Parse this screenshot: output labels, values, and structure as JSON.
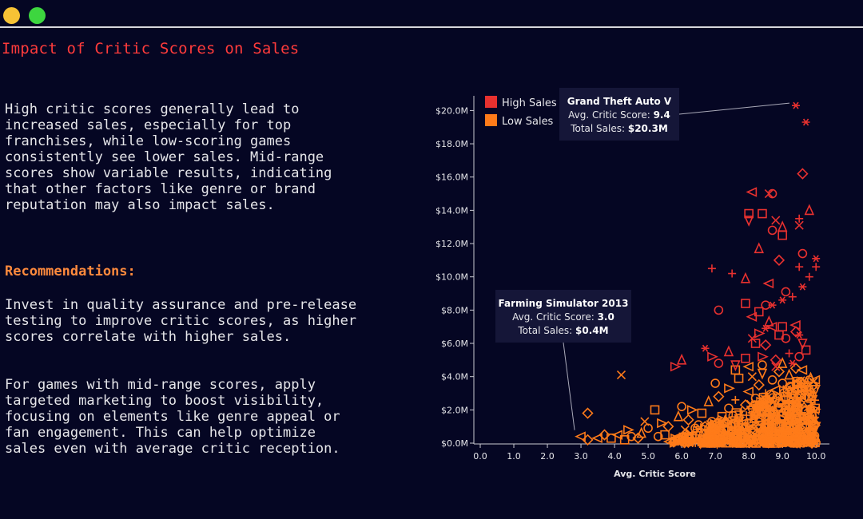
{
  "window": {
    "dots": [
      {
        "icon": "minimize-dot-icon",
        "color": "#f7c235"
      },
      {
        "icon": "maximize-dot-icon",
        "color": "#3dd63f"
      }
    ],
    "divider_color": "#d7d7dc"
  },
  "title": "Impact of Critic Scores on Sales",
  "colors": {
    "title": "#ff3b3b",
    "heading": "#ff8a3d",
    "text": "#e6e6ea",
    "background": "#050623",
    "high_sales": "#e8312f",
    "low_sales": "#ff7b19",
    "tooltip_bg": "#151638"
  },
  "insight": "High critic scores generally lead to increased sales, especially for top franchises, while low-scoring games consistently see lower sales. Mid-range scores show variable results, indicating that other factors like genre or brand reputation may also impact sales.",
  "recommendations": {
    "heading": "Recommendations:",
    "items": [
      "Invest in quality assurance and pre-release testing to improve critic scores, as higher scores correlate with higher sales.",
      "For games with mid-range scores, apply targeted marketing to boost visibility, focusing on elements like genre appeal or fan engagement. This can help optimize sales even with average critic reception."
    ]
  },
  "chart_data": {
    "type": "scatter",
    "xlabel": "Avg. Critic Score",
    "ylabel": "",
    "xlim": [
      0,
      10.4
    ],
    "ylim": [
      0,
      20.5
    ],
    "x_ticks": [
      0,
      1,
      2,
      3,
      4,
      5,
      6,
      7,
      8,
      9,
      10
    ],
    "x_tick_labels": [
      "0.0",
      "1.0",
      "2.0",
      "3.0",
      "4.0",
      "5.0",
      "6.0",
      "7.0",
      "8.0",
      "9.0",
      "10.0"
    ],
    "y_ticks": [
      0,
      2,
      4,
      6,
      8,
      10,
      12,
      14,
      16,
      18,
      20
    ],
    "y_tick_labels": [
      "$0.0M",
      "$2.0M",
      "$4.0M",
      "$6.0M",
      "$8.0M",
      "$10.0M",
      "$12.0M",
      "$14.0M",
      "$16.0M",
      "$18.0M",
      "$20.0M"
    ],
    "grid": false,
    "legend_position": "top-left",
    "series": [
      {
        "name": "High Sales",
        "color": "#e8312f",
        "points": [
          [
            9.4,
            20.3,
            "asterisk"
          ],
          [
            9.7,
            19.3,
            "asterisk"
          ],
          [
            9.6,
            16.2,
            "diamond"
          ],
          [
            8.7,
            15.0,
            "circle"
          ],
          [
            8.6,
            15.0,
            "x"
          ],
          [
            8.1,
            15.1,
            "triangle-left"
          ],
          [
            8.0,
            13.8,
            "square"
          ],
          [
            8.0,
            13.4,
            "triangle-down"
          ],
          [
            8.4,
            13.8,
            "square"
          ],
          [
            8.8,
            13.4,
            "x"
          ],
          [
            9.5,
            13.5,
            "plus"
          ],
          [
            9.5,
            13.1,
            "x"
          ],
          [
            9.8,
            14.0,
            "triangle-up"
          ],
          [
            8.7,
            12.8,
            "circle"
          ],
          [
            9.0,
            13.0,
            "triangle-up"
          ],
          [
            8.3,
            11.7,
            "triangle-up"
          ],
          [
            9.0,
            12.5,
            "square"
          ],
          [
            9.6,
            11.4,
            "circle"
          ],
          [
            10.0,
            11.1,
            "asterisk"
          ],
          [
            10.0,
            10.6,
            "plus"
          ],
          [
            8.9,
            11.0,
            "diamond"
          ],
          [
            9.5,
            10.6,
            "plus"
          ],
          [
            9.8,
            10.0,
            "plus"
          ],
          [
            9.6,
            9.4,
            "asterisk"
          ],
          [
            9.1,
            9.1,
            "circle"
          ],
          [
            9.3,
            8.8,
            "plus"
          ],
          [
            9.0,
            8.6,
            "asterisk"
          ],
          [
            8.7,
            8.3,
            "asterisk"
          ],
          [
            6.9,
            10.5,
            "plus"
          ],
          [
            7.5,
            10.2,
            "plus"
          ],
          [
            7.9,
            9.9,
            "triangle-up"
          ],
          [
            8.6,
            9.6,
            "triangle-left"
          ],
          [
            8.5,
            8.3,
            "circle"
          ],
          [
            7.9,
            8.4,
            "square"
          ],
          [
            7.1,
            8.0,
            "circle"
          ],
          [
            8.3,
            7.9,
            "square"
          ],
          [
            8.1,
            7.6,
            "triangle-left"
          ],
          [
            8.6,
            7.3,
            "triangle-up"
          ],
          [
            8.7,
            7.0,
            "triangle-left"
          ],
          [
            8.5,
            6.9,
            "asterisk"
          ],
          [
            9.0,
            7.0,
            "square"
          ],
          [
            9.4,
            7.1,
            "triangle-left"
          ],
          [
            8.3,
            6.6,
            "triangle-right"
          ],
          [
            8.9,
            6.5,
            "square"
          ],
          [
            9.1,
            6.3,
            "circle"
          ],
          [
            8.1,
            6.3,
            "x"
          ],
          [
            8.2,
            6.0,
            "square"
          ],
          [
            8.5,
            5.9,
            "diamond"
          ],
          [
            9.4,
            6.7,
            "diamond"
          ],
          [
            9.5,
            6.5,
            "asterisk"
          ],
          [
            9.6,
            6.0,
            "triangle-down"
          ],
          [
            6.7,
            5.7,
            "asterisk"
          ],
          [
            7.4,
            5.5,
            "triangle-up"
          ],
          [
            6.9,
            5.2,
            "triangle-right"
          ],
          [
            7.9,
            5.1,
            "square"
          ],
          [
            8.4,
            5.2,
            "triangle-right"
          ],
          [
            8.8,
            5.0,
            "diamond"
          ],
          [
            9.2,
            5.4,
            "plus"
          ],
          [
            9.5,
            5.2,
            "circle"
          ],
          [
            9.7,
            5.6,
            "square"
          ],
          [
            6.0,
            5.0,
            "triangle-up"
          ],
          [
            5.8,
            4.6,
            "triangle-right"
          ],
          [
            7.1,
            4.8,
            "circle"
          ],
          [
            7.6,
            4.7,
            "triangle-down"
          ],
          [
            8.8,
            4.6,
            "x"
          ],
          [
            9.3,
            4.8,
            "asterisk"
          ]
        ]
      },
      {
        "name": "Low Sales",
        "color": "#ff7b19",
        "points": [
          [
            3.0,
            0.4,
            "triangle-left"
          ],
          [
            3.2,
            0.2,
            "diamond"
          ],
          [
            3.2,
            1.8,
            "diamond"
          ],
          [
            3.5,
            0.3,
            "triangle-left"
          ],
          [
            3.7,
            0.5,
            "diamond"
          ],
          [
            3.9,
            0.3,
            "square"
          ],
          [
            4.1,
            0.5,
            "triangle-left"
          ],
          [
            4.3,
            0.2,
            "square"
          ],
          [
            4.2,
            4.1,
            "x"
          ],
          [
            4.4,
            0.8,
            "triangle-right"
          ],
          [
            4.5,
            0.4,
            "circle"
          ],
          [
            4.8,
            0.6,
            "triangle-up"
          ],
          [
            4.9,
            1.3,
            "x"
          ],
          [
            5.0,
            0.9,
            "circle"
          ],
          [
            5.2,
            2.0,
            "square"
          ],
          [
            5.4,
            1.2,
            "triangle-right"
          ],
          [
            5.5,
            0.5,
            "square"
          ],
          [
            5.6,
            1.0,
            "diamond"
          ],
          [
            5.8,
            0.3,
            "triangle-left"
          ],
          [
            5.9,
            1.6,
            "triangle-up"
          ],
          [
            6.0,
            2.2,
            "circle"
          ],
          [
            6.1,
            0.8,
            "x"
          ],
          [
            6.2,
            1.4,
            "diamond"
          ],
          [
            6.3,
            0.4,
            "square"
          ],
          [
            6.3,
            2.0,
            "triangle-right"
          ],
          [
            6.5,
            1.1,
            "circle"
          ],
          [
            6.6,
            1.8,
            "square"
          ],
          [
            6.7,
            0.6,
            "triangle-down"
          ],
          [
            6.8,
            2.5,
            "triangle-up"
          ],
          [
            6.9,
            1.3,
            "circle"
          ],
          [
            7.0,
            0.7,
            "x"
          ],
          [
            7.0,
            3.6,
            "circle"
          ],
          [
            7.1,
            2.8,
            "diamond"
          ],
          [
            7.2,
            1.6,
            "square"
          ],
          [
            7.3,
            0.5,
            "triangle-left"
          ],
          [
            7.4,
            2.1,
            "circle"
          ],
          [
            7.4,
            3.3,
            "triangle-right"
          ],
          [
            7.5,
            1.0,
            "diamond"
          ],
          [
            7.6,
            2.6,
            "plus"
          ],
          [
            7.7,
            1.5,
            "circle"
          ],
          [
            7.7,
            3.9,
            "square"
          ],
          [
            7.8,
            0.8,
            "triangle-up"
          ],
          [
            7.9,
            2.3,
            "diamond"
          ],
          [
            8.0,
            1.2,
            "circle"
          ],
          [
            8.0,
            3.1,
            "triangle-left"
          ],
          [
            8.1,
            4.0,
            "x"
          ],
          [
            8.1,
            0.6,
            "square"
          ],
          [
            8.2,
            2.7,
            "circle"
          ],
          [
            8.2,
            1.7,
            "triangle-right"
          ],
          [
            8.3,
            3.5,
            "diamond"
          ],
          [
            8.3,
            0.9,
            "circle"
          ],
          [
            8.4,
            2.2,
            "square"
          ],
          [
            8.4,
            4.2,
            "triangle-down"
          ],
          [
            8.5,
            1.4,
            "circle"
          ],
          [
            8.5,
            3.0,
            "plus"
          ],
          [
            8.6,
            0.7,
            "x"
          ],
          [
            8.6,
            2.5,
            "diamond"
          ],
          [
            8.7,
            3.8,
            "circle"
          ],
          [
            8.7,
            1.9,
            "triangle-up"
          ],
          [
            8.8,
            1.1,
            "square"
          ],
          [
            8.8,
            3.2,
            "triangle-left"
          ],
          [
            8.9,
            2.4,
            "circle"
          ],
          [
            8.9,
            4.3,
            "diamond"
          ],
          [
            9.0,
            1.5,
            "triangle-right"
          ],
          [
            9.0,
            3.6,
            "circle"
          ],
          [
            9.1,
            2.8,
            "square"
          ],
          [
            9.1,
            0.8,
            "circle"
          ],
          [
            9.2,
            1.9,
            "diamond"
          ],
          [
            9.2,
            4.1,
            "triangle-up"
          ],
          [
            9.3,
            3.0,
            "circle"
          ],
          [
            9.3,
            1.2,
            "plus"
          ],
          [
            9.4,
            2.3,
            "square"
          ],
          [
            9.4,
            3.7,
            "x"
          ],
          [
            9.5,
            1.6,
            "circle"
          ],
          [
            9.5,
            2.9,
            "diamond"
          ],
          [
            9.6,
            4.4,
            "triangle-left"
          ],
          [
            9.6,
            1.0,
            "circle"
          ],
          [
            9.7,
            2.0,
            "square"
          ],
          [
            9.7,
            3.2,
            "asterisk"
          ],
          [
            9.8,
            1.3,
            "diamond"
          ],
          [
            9.8,
            0.6,
            "circle"
          ],
          [
            9.9,
            2.6,
            "triangle-down"
          ],
          [
            10.0,
            1.0,
            "triangle-down"
          ],
          [
            9.9,
            0.8,
            "circle"
          ],
          [
            8.0,
            4.6,
            "triangle-left"
          ],
          [
            8.4,
            4.7,
            "circle"
          ],
          [
            7.6,
            4.4,
            "square"
          ],
          [
            9.0,
            4.8,
            "triangle-up"
          ],
          [
            9.4,
            4.5,
            "diamond"
          ],
          [
            6.4,
            0.9,
            "circle"
          ],
          [
            6.9,
            0.4,
            "square"
          ],
          [
            7.3,
            1.2,
            "circle"
          ],
          [
            7.6,
            0.5,
            "triangle-up"
          ],
          [
            8.0,
            0.3,
            "circle"
          ],
          [
            8.5,
            0.4,
            "diamond"
          ],
          [
            8.9,
            0.5,
            "circle"
          ],
          [
            9.3,
            0.6,
            "square"
          ],
          [
            5.3,
            0.4,
            "circle"
          ],
          [
            4.7,
            0.3,
            "diamond"
          ],
          [
            6.6,
            0.3,
            "triangle-left"
          ],
          [
            7.1,
            0.2,
            "circle"
          ],
          [
            7.9,
            0.4,
            "triangle-right"
          ],
          [
            8.3,
            0.2,
            "square"
          ],
          [
            8.7,
            0.3,
            "triangle-down"
          ],
          [
            9.2,
            0.3,
            "circle"
          ],
          [
            9.6,
            0.4,
            "triangle-up"
          ]
        ]
      }
    ],
    "annotations": [
      {
        "title": "Grand Theft Auto V",
        "score_label": "Avg. Critic Score: ",
        "score_value": "9.4",
        "sales_label": "Total Sales: ",
        "sales_value": "$20.3M",
        "point": [
          9.4,
          20.3
        ],
        "placement": "left-of-point"
      },
      {
        "title": "Farming Simulator 2013",
        "score_label": "Avg. Critic Score: ",
        "score_value": "3.0",
        "sales_label": "Total Sales: ",
        "sales_value": "$0.4M",
        "point": [
          3.0,
          0.4
        ],
        "placement": "above-point"
      }
    ]
  }
}
